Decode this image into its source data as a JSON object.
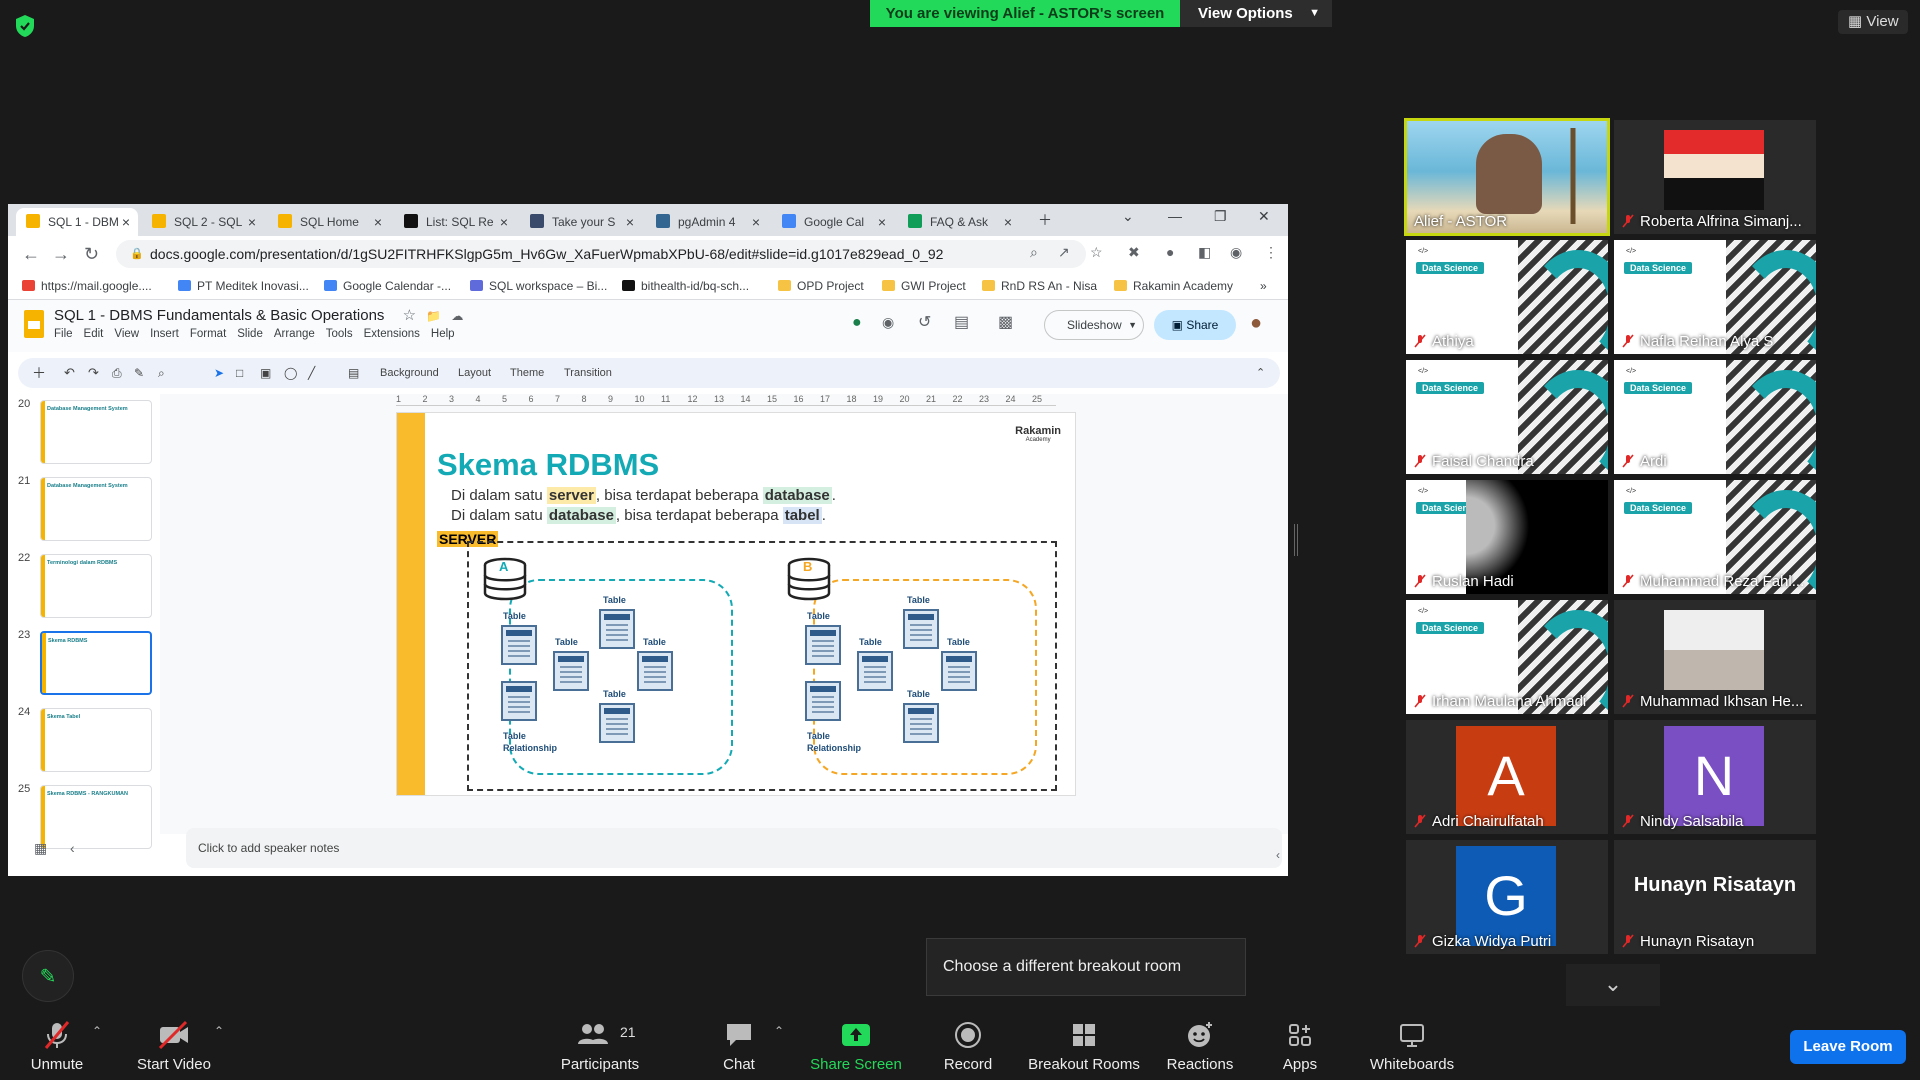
{
  "banner": {
    "text": "You are viewing Alief - ASTOR's screen",
    "view_options": "View Options",
    "view": "View"
  },
  "browser": {
    "tabs": [
      {
        "label": "SQL 1 - DBM",
        "color": "#f6b400"
      },
      {
        "label": "SQL 2 - SQL",
        "color": "#f6b400"
      },
      {
        "label": "SQL Home",
        "color": "#f6b400"
      },
      {
        "label": "List: SQL Re",
        "color": "#111111"
      },
      {
        "label": "Take your S",
        "color": "#3a4a6b"
      },
      {
        "label": "pgAdmin 4",
        "color": "#336791"
      },
      {
        "label": "Google Cal",
        "color": "#4285f4"
      },
      {
        "label": "FAQ & Ask",
        "color": "#0f9d58"
      }
    ],
    "url": "docs.google.com/presentation/d/1gSU2FITRHFKSlgpG5m_Hv6Gw_XaFuerWpmabXPbU-68/edit#slide=id.g1017e829ead_0_92",
    "bookmarks": [
      {
        "label": "https://mail.google....",
        "color": "#ea4335"
      },
      {
        "label": "PT Meditek Inovasi...",
        "color": "#4285f4"
      },
      {
        "label": "Google Calendar -...",
        "color": "#4285f4"
      },
      {
        "label": "SQL workspace – Bi...",
        "color": "#5f6bdb"
      },
      {
        "label": "bithealth-id/bq-sch...",
        "color": "#111111"
      },
      {
        "label": "OPD Project",
        "color": "#f6c344"
      },
      {
        "label": "GWI Project",
        "color": "#f6c344"
      },
      {
        "label": "RnD RS An - Nisa",
        "color": "#f6c344"
      },
      {
        "label": "Rakamin Academy",
        "color": "#f6c344"
      }
    ]
  },
  "slides_app": {
    "title": "SQL 1 - DBMS Fundamentals & Basic Operations",
    "menus": [
      "File",
      "Edit",
      "View",
      "Insert",
      "Format",
      "Slide",
      "Arrange",
      "Tools",
      "Extensions",
      "Help"
    ],
    "slideshow": "Slideshow",
    "share": "Share",
    "toolbar": {
      "background": "Background",
      "layout": "Layout",
      "theme": "Theme",
      "transition": "Transition"
    },
    "thumbnails": [
      {
        "num": "20",
        "title": "Database Management System"
      },
      {
        "num": "21",
        "title": "Database Management System"
      },
      {
        "num": "22",
        "title": "Terminologi dalam RDBMS"
      },
      {
        "num": "23",
        "title": "Skema RDBMS"
      },
      {
        "num": "24",
        "title": "Skema Tabel"
      },
      {
        "num": "25",
        "title": "Skema RDBMS - RANGKUMAN"
      }
    ],
    "ruler": [
      "1",
      "2",
      "3",
      "4",
      "5",
      "6",
      "7",
      "8",
      "9",
      "10",
      "11",
      "12",
      "13",
      "14",
      "15",
      "16",
      "17",
      "18",
      "19",
      "20",
      "21",
      "22",
      "23",
      "24",
      "25"
    ],
    "notes_placeholder": "Click to add speaker notes"
  },
  "slide": {
    "title": "Skema RDBMS",
    "line1": {
      "a": "Di dalam satu ",
      "b": "server",
      "c": ", bisa terdapat beberapa ",
      "d": "database",
      "e": "."
    },
    "line2": {
      "a": "Di dalam satu ",
      "b": "database",
      "c": ", bisa terdapat beberapa ",
      "d": "tabel",
      "e": "."
    },
    "server_label": "SERVER",
    "logo": "Rakamin",
    "logo_sub": "Academy",
    "db_a": "A",
    "db_b": "B",
    "table_label": "Table",
    "relationship_label": "Relationship",
    "colors": {
      "teal": "#13aab5",
      "yellow": "#f9bb2c",
      "orange": "#f5a623"
    }
  },
  "participants": [
    {
      "name": "Alief - ASTOR",
      "type": "video",
      "muted": false
    },
    {
      "name": "Roberta Alfrina Simanj...",
      "type": "photo",
      "muted": true
    },
    {
      "name": "Athiya",
      "type": "rakamin",
      "muted": true
    },
    {
      "name": "Nafla Reihan Alya S",
      "type": "rakamin",
      "muted": true
    },
    {
      "name": "Faisal Chandra",
      "type": "rakamin",
      "muted": true
    },
    {
      "name": "Ardi",
      "type": "rakamin",
      "muted": true
    },
    {
      "name": "Ruslan Hadi",
      "type": "rakamin-dark",
      "muted": true
    },
    {
      "name": "Muhammad Reza Fahl...",
      "type": "rakamin",
      "muted": true
    },
    {
      "name": "Irham Maulana Ahmadi",
      "type": "rakamin",
      "muted": true
    },
    {
      "name": "Muhammad Ikhsan He...",
      "type": "photo",
      "muted": true
    },
    {
      "name": "Adri Chairulfatah",
      "type": "letter",
      "letter": "A",
      "color": "#c83c12",
      "muted": true
    },
    {
      "name": "Nindy Salsabila",
      "type": "letter",
      "letter": "N",
      "color": "#7b4fc4",
      "muted": true
    },
    {
      "name": "Gizka Widya Putri",
      "type": "letter",
      "letter": "G",
      "color": "#0d5bb5",
      "muted": true
    },
    {
      "name": "Hunayn Risatayn",
      "type": "text",
      "big": "Hunayn Risatayn",
      "muted": true
    }
  ],
  "choose_room": "Choose a different breakout room",
  "controls": {
    "unmute": "Unmute",
    "start_video": "Start Video",
    "participants": "Participants",
    "participants_count": "21",
    "chat": "Chat",
    "share_screen": "Share Screen",
    "record": "Record",
    "breakout": "Breakout Rooms",
    "reactions": "Reactions",
    "apps": "Apps",
    "whiteboards": "Whiteboards",
    "leave": "Leave Room"
  }
}
